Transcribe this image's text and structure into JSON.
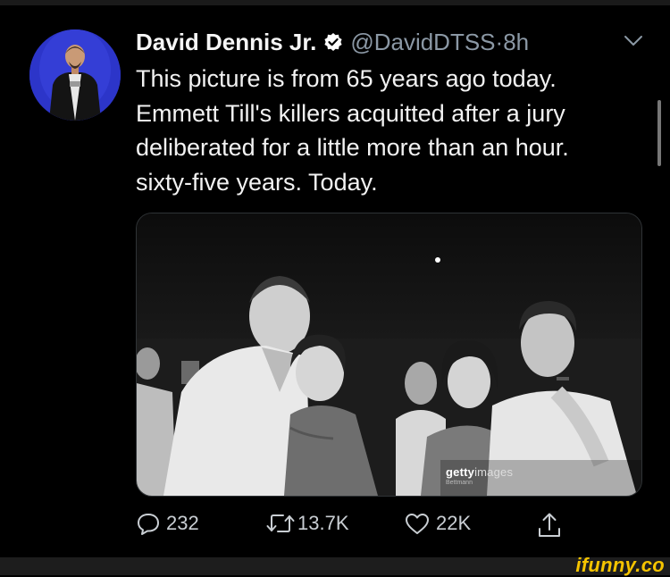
{
  "tweet": {
    "author_name": "David Dennis Jr.",
    "handle": "@DavidDTSS",
    "separator": " · ",
    "time": "8h",
    "text_lines": [
      "This picture is from 65 years ago today.",
      "Emmett Till's killers  acquitted after a jury",
      "deliberated for a little more than an hour.",
      "sixty-five years. Today."
    ]
  },
  "media": {
    "watermark_brand_bold": "getty",
    "watermark_brand_light": "images",
    "watermark_sub": "Bettmann"
  },
  "actions": {
    "replies": "232",
    "retweets": "13.7K",
    "likes": "22K"
  },
  "footer": {
    "brand": "ifunny.co"
  },
  "icons": [
    "verified-badge-icon",
    "chevron-down-icon",
    "reply-icon",
    "retweet-icon",
    "like-heart-icon",
    "share-icon"
  ],
  "colors": {
    "background": "#000000",
    "secondary_text": "#8b98a5",
    "verified_badge": "#ffffff",
    "ifunny_yellow": "#f5c400"
  }
}
